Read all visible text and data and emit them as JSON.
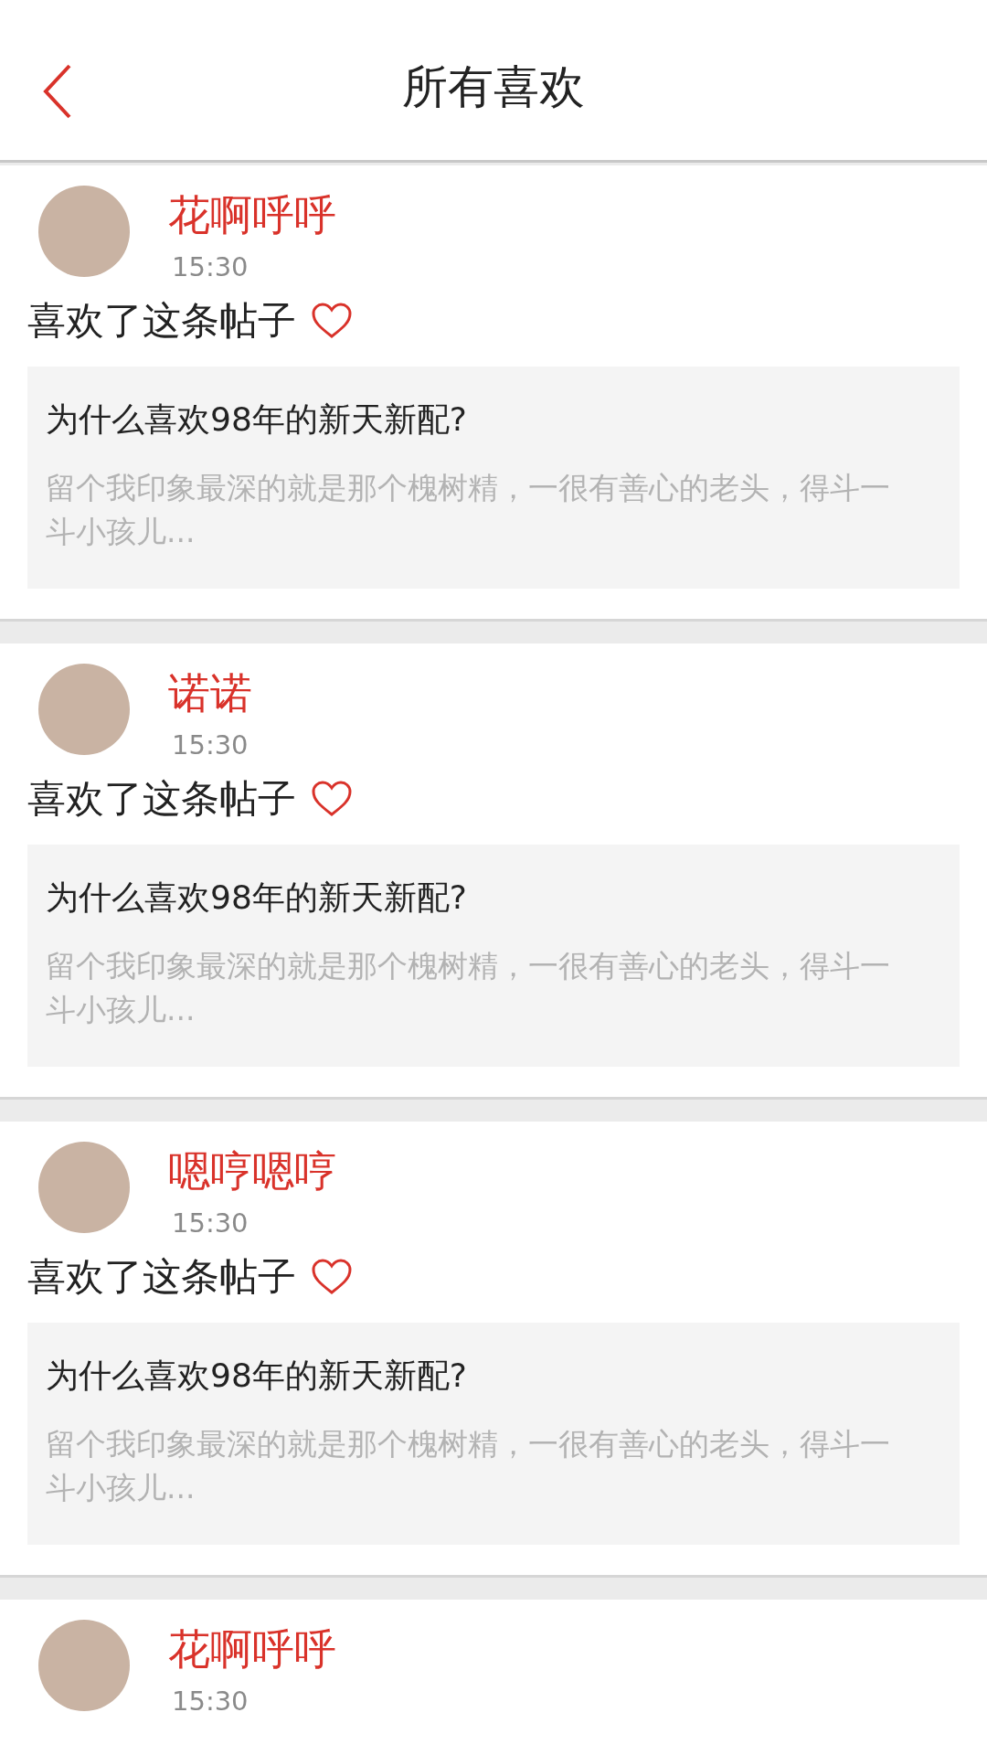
{
  "header": {
    "title": "所有喜欢"
  },
  "items": [
    {
      "user": "花啊呼呼",
      "time": "15:30",
      "action": "喜欢了这条帖子",
      "post": {
        "title": "为什么喜欢98年的新天新配?",
        "excerpt": "留个我印象最深的就是那个槐树精，一很有善心的老头，得斗一斗小孩儿..."
      }
    },
    {
      "user": "诺诺",
      "time": "15:30",
      "action": "喜欢了这条帖子",
      "post": {
        "title": "为什么喜欢98年的新天新配?",
        "excerpt": "留个我印象最深的就是那个槐树精，一很有善心的老头，得斗一斗小孩儿..."
      }
    },
    {
      "user": "嗯哼嗯哼",
      "time": "15:30",
      "action": "喜欢了这条帖子",
      "post": {
        "title": "为什么喜欢98年的新天新配?",
        "excerpt": "留个我印象最深的就是那个槐树精，一很有善心的老头，得斗一斗小孩儿..."
      }
    },
    {
      "user": "花啊呼呼",
      "time": "15:30"
    }
  ]
}
